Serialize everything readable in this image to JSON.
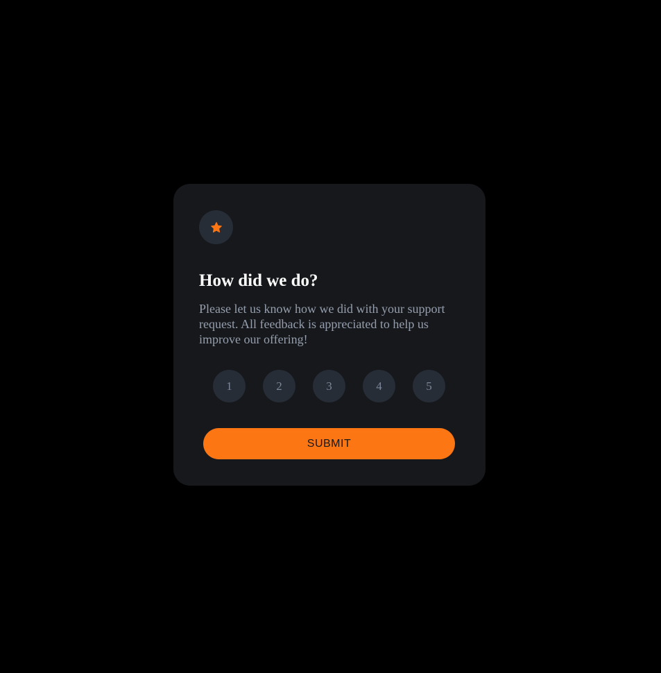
{
  "card": {
    "icon": "star-icon",
    "title": "How did we do?",
    "description": "Please let us know how we did with your support request. All feedback is appreciated to help us improve our offering!",
    "ratings": [
      "1",
      "2",
      "3",
      "4",
      "5"
    ],
    "submit_label": "SUBMIT"
  },
  "colors": {
    "background": "#000000",
    "card": "#16181c",
    "accent": "#fc7614",
    "circle": "#262d37",
    "text_muted": "#969fad",
    "rating_text": "#7c8798"
  }
}
